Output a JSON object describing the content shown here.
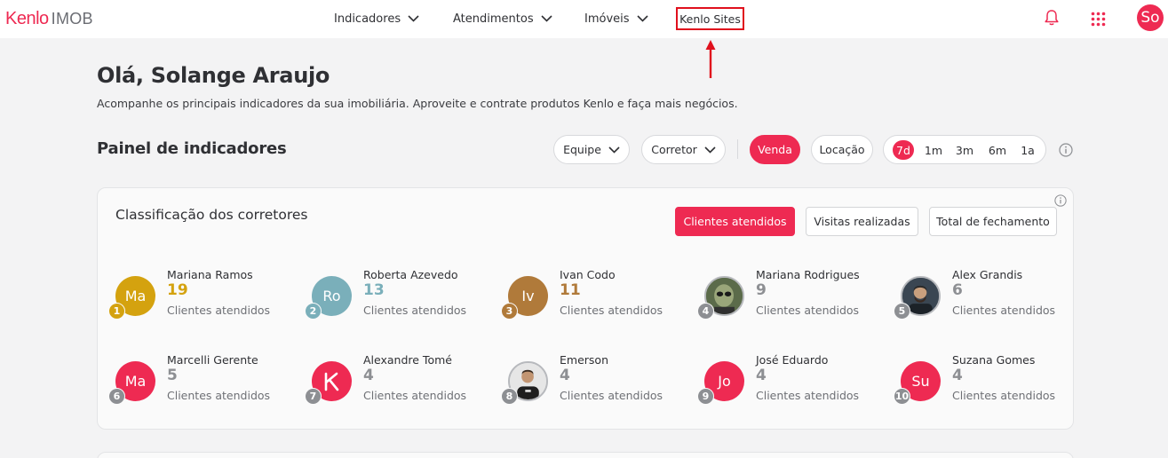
{
  "header": {
    "logo_brand": "Kenlo",
    "logo_product": "IMOB",
    "nav": [
      {
        "label": "Indicadores"
      },
      {
        "label": "Atendimentos"
      },
      {
        "label": "Imóveis"
      }
    ],
    "sites_label": "Kenlo Sites",
    "avatar_initials": "So"
  },
  "greeting": {
    "title": "Olá, Solange Araujo",
    "subtitle": "Acompanhe os principais indicadores da sua imobiliária. Aproveite e contrate produtos Kenlo e faça mais negócios."
  },
  "panel": {
    "title": "Painel de indicadores",
    "filters": {
      "team": "Equipe",
      "broker": "Corretor"
    },
    "business": {
      "sale": "Venda",
      "rent": "Locação",
      "selected": "Venda"
    },
    "periods": [
      "7d",
      "1m",
      "3m",
      "6m",
      "1a"
    ],
    "period_selected": "7d"
  },
  "ranking": {
    "title": "Classificação dos corretores",
    "tabs": [
      "Clientes atendidos",
      "Visitas realizadas",
      "Total de fechamento"
    ],
    "tab_selected": "Clientes atendidos",
    "metric_label": "Clientes atendidos",
    "brokers": [
      {
        "rank": "1",
        "name": "Mariana Ramos",
        "value": "19",
        "initials": "Ma",
        "avatar_color": "#d4a20f",
        "value_color": "#d4a20f",
        "badge_color": "#d4a20f"
      },
      {
        "rank": "2",
        "name": "Roberta Azevedo",
        "value": "13",
        "initials": "Ro",
        "avatar_color": "#7aafba",
        "value_color": "#7aafba",
        "badge_color": "#7aafba"
      },
      {
        "rank": "3",
        "name": "Ivan Codo",
        "value": "11",
        "initials": "Iv",
        "avatar_color": "#b07a3a",
        "value_color": "#b07a3a",
        "badge_color": "#b07a3a"
      },
      {
        "rank": "4",
        "name": "Mariana Rodrigues",
        "value": "9",
        "initials": "",
        "avatar_color": "#4a5a3a",
        "value_color": "#8d8f93",
        "badge_color": "#8d8f93",
        "photo": "alien"
      },
      {
        "rank": "5",
        "name": "Alex Grandis",
        "value": "6",
        "initials": "",
        "avatar_color": "#2f3a44",
        "value_color": "#8d8f93",
        "badge_color": "#8d8f93",
        "photo": "man"
      },
      {
        "rank": "6",
        "name": "Marcelli Gerente",
        "value": "5",
        "initials": "Ma",
        "avatar_color": "#ee2a52",
        "value_color": "#8d8f93",
        "badge_color": "#8d8f93"
      },
      {
        "rank": "7",
        "name": "Alexandre Tomé",
        "value": "4",
        "initials": "",
        "avatar_color": "#ee2a52",
        "value_color": "#8d8f93",
        "badge_color": "#8d8f93",
        "photo": "kenlo"
      },
      {
        "rank": "8",
        "name": "Emerson",
        "value": "4",
        "initials": "",
        "avatar_color": "#e8e8e8",
        "value_color": "#8d8f93",
        "badge_color": "#8d8f93",
        "photo": "man2"
      },
      {
        "rank": "9",
        "name": "José Eduardo",
        "value": "4",
        "initials": "Jo",
        "avatar_color": "#ee2a52",
        "value_color": "#8d8f93",
        "badge_color": "#8d8f93"
      },
      {
        "rank": "10",
        "name": "Suzana Gomes",
        "value": "4",
        "initials": "Su",
        "avatar_color": "#ee2a52",
        "value_color": "#8d8f93",
        "badge_color": "#8d8f93"
      }
    ]
  },
  "colors": {
    "brand": "#ee2a52",
    "highlight_box": "#e0101d"
  },
  "icons": {
    "bell": "bell-icon",
    "apps": "apps-grid-icon",
    "info": "info-icon",
    "chevron": "chevron-down-icon"
  }
}
